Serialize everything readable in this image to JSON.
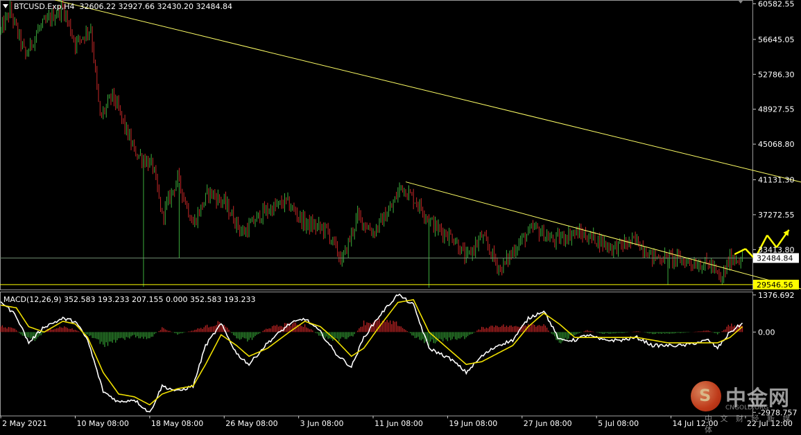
{
  "header": {
    "symbol": "BTCUSD.Exp,H4",
    "ohlc": "32606.22 32927.66 32430.20 32484.84"
  },
  "macd_header": "MACD(12,26,9) 352.583 193.233 207.155 0.000 352.583 193.233",
  "watermark": {
    "title": "中金网",
    "sub_en": "CNGOLD.ORG",
    "sub_cn": "中 文 财 经 新 媒 体"
  },
  "colors": {
    "background": "#000000",
    "bull": "#3dae3d",
    "bear": "#c82828",
    "trendline": "#ffff66",
    "support": "#ffff00",
    "price_level": "#6e8a70",
    "macd_line": "#ffffff",
    "signal_line": "#f0e000",
    "hist_pos": "#b22222",
    "hist_neg": "#2e8b2e",
    "axis_text": "#ffffff"
  },
  "chart_data": [
    {
      "type": "candlestick",
      "title": "BTCUSD.Exp,H4",
      "ylim": [
        29000,
        61000
      ],
      "y_ticks": [
        "60582.55",
        "56645.05",
        "52786.30",
        "48927.55",
        "45068.80",
        "41131.30",
        "37272.55",
        "33413.80"
      ],
      "y_tick_values": [
        60582.55,
        56645.05,
        52786.3,
        48927.55,
        45068.8,
        41131.3,
        37272.55,
        33413.8
      ],
      "x_ticks": [
        "2 May 2021",
        "10 May 08:00",
        "18 May 08:00",
        "26 May 08:00",
        "3 Jun 08:00",
        "11 Jun 08:00",
        "19 Jun 08:00",
        "27 Jun 08:00",
        "5 Jul 08:00",
        "14 Jul 12:00",
        "22 Jul 12:00"
      ],
      "x_tick_values": [
        0,
        48,
        96,
        144,
        192,
        240,
        288,
        336,
        384,
        432,
        480
      ],
      "current_price": {
        "label": "32484.84",
        "value": 32484.84
      },
      "support_level": {
        "label": "29546.56",
        "value": 29546.56
      },
      "trendlines": [
        {
          "name": "upper-resistance",
          "from": [
            35,
            61000
          ],
          "to": [
            520,
            40700
          ]
        },
        {
          "name": "lower-resistance",
          "from": [
            261,
            40900
          ],
          "to": [
            520,
            28880
          ]
        }
      ],
      "forecast_path": [
        [
          473,
          32900
        ],
        [
          480,
          33500
        ],
        [
          486,
          32400
        ],
        [
          494,
          35000
        ],
        [
          500,
          33650
        ],
        [
          508,
          35600
        ]
      ],
      "price_path": [
        [
          0,
          57600
        ],
        [
          6,
          59800
        ],
        [
          16,
          54800
        ],
        [
          24,
          57700
        ],
        [
          34,
          59300
        ],
        [
          40,
          60200
        ],
        [
          48,
          56200
        ],
        [
          58,
          57900
        ],
        [
          64,
          47900
        ],
        [
          72,
          50500
        ],
        [
          86,
          44300
        ],
        [
          98,
          42600
        ],
        [
          104,
          37100
        ],
        [
          114,
          41300
        ],
        [
          124,
          36200
        ],
        [
          134,
          39800
        ],
        [
          144,
          38600
        ],
        [
          156,
          35200
        ],
        [
          168,
          37400
        ],
        [
          184,
          38700
        ],
        [
          196,
          36300
        ],
        [
          210,
          35600
        ],
        [
          220,
          32100
        ],
        [
          230,
          37100
        ],
        [
          240,
          35300
        ],
        [
          252,
          38100
        ],
        [
          258,
          40500
        ],
        [
          268,
          38700
        ],
        [
          280,
          35900
        ],
        [
          292,
          34700
        ],
        [
          300,
          32400
        ],
        [
          310,
          34900
        ],
        [
          322,
          31200
        ],
        [
          334,
          34200
        ],
        [
          344,
          35800
        ],
        [
          356,
          34400
        ],
        [
          370,
          35300
        ],
        [
          384,
          34600
        ],
        [
          394,
          33600
        ],
        [
          410,
          34400
        ],
        [
          420,
          32600
        ],
        [
          434,
          32400
        ],
        [
          448,
          31900
        ],
        [
          458,
          31700
        ],
        [
          464,
          29900
        ],
        [
          470,
          32400
        ],
        [
          478,
          32484
        ]
      ]
    },
    {
      "type": "line",
      "title": "MACD(12,26,9)",
      "ylim": [
        -3100,
        1500
      ],
      "y_ticks": [
        "1376.692",
        "0.00",
        "-2978.757"
      ],
      "y_tick_values": [
        1376.692,
        0,
        -2978.757
      ],
      "series": [
        {
          "name": "MACD",
          "points": [
            [
              0,
              1150
            ],
            [
              10,
              600
            ],
            [
              18,
              -400
            ],
            [
              28,
              200
            ],
            [
              40,
              500
            ],
            [
              48,
              400
            ],
            [
              56,
              -300
            ],
            [
              66,
              -2200
            ],
            [
              76,
              -2600
            ],
            [
              86,
              -2500
            ],
            [
              96,
              -3000
            ],
            [
              104,
              -2000
            ],
            [
              114,
              -2200
            ],
            [
              124,
              -2000
            ],
            [
              132,
              -500
            ],
            [
              142,
              300
            ],
            [
              152,
              -800
            ],
            [
              160,
              -1200
            ],
            [
              172,
              -400
            ],
            [
              186,
              300
            ],
            [
              196,
              500
            ],
            [
              206,
              0
            ],
            [
              216,
              -800
            ],
            [
              226,
              -1300
            ],
            [
              234,
              -200
            ],
            [
              244,
              600
            ],
            [
              256,
              1400
            ],
            [
              266,
              1000
            ],
            [
              276,
              -600
            ],
            [
              290,
              -1000
            ],
            [
              300,
              -1500
            ],
            [
              310,
              -900
            ],
            [
              320,
              -500
            ],
            [
              330,
              -300
            ],
            [
              340,
              500
            ],
            [
              350,
              800
            ],
            [
              360,
              -300
            ],
            [
              370,
              -300
            ],
            [
              378,
              -100
            ],
            [
              388,
              -300
            ],
            [
              400,
              -300
            ],
            [
              410,
              -200
            ],
            [
              420,
              -500
            ],
            [
              430,
              -500
            ],
            [
              440,
              -500
            ],
            [
              456,
              -300
            ],
            [
              462,
              -600
            ],
            [
              470,
              0
            ],
            [
              480,
              400
            ]
          ]
        },
        {
          "name": "Signal",
          "points": [
            [
              0,
              1000
            ],
            [
              10,
              900
            ],
            [
              18,
              200
            ],
            [
              28,
              0
            ],
            [
              40,
              400
            ],
            [
              48,
              300
            ],
            [
              56,
              -200
            ],
            [
              66,
              -1500
            ],
            [
              76,
              -2300
            ],
            [
              86,
              -2400
            ],
            [
              96,
              -2700
            ],
            [
              104,
              -2300
            ],
            [
              114,
              -2100
            ],
            [
              124,
              -2000
            ],
            [
              132,
              -1200
            ],
            [
              142,
              -100
            ],
            [
              152,
              -500
            ],
            [
              160,
              -900
            ],
            [
              172,
              -600
            ],
            [
              186,
              0
            ],
            [
              196,
              400
            ],
            [
              206,
              200
            ],
            [
              216,
              -300
            ],
            [
              226,
              -900
            ],
            [
              234,
              -600
            ],
            [
              244,
              200
            ],
            [
              256,
              1100
            ],
            [
              266,
              1200
            ],
            [
              276,
              0
            ],
            [
              290,
              -700
            ],
            [
              300,
              -1200
            ],
            [
              310,
              -1100
            ],
            [
              320,
              -800
            ],
            [
              330,
              -500
            ],
            [
              340,
              200
            ],
            [
              350,
              700
            ],
            [
              360,
              300
            ],
            [
              370,
              -200
            ],
            [
              378,
              -200
            ],
            [
              388,
              -200
            ],
            [
              400,
              -200
            ],
            [
              410,
              -200
            ],
            [
              420,
              -300
            ],
            [
              430,
              -400
            ],
            [
              440,
              -400
            ],
            [
              456,
              -400
            ],
            [
              462,
              -400
            ],
            [
              470,
              -200
            ],
            [
              480,
              300
            ]
          ]
        },
        {
          "name": "Histogram",
          "points": [
            [
              0,
              200
            ],
            [
              8,
              150
            ],
            [
              14,
              -120
            ],
            [
              22,
              -300
            ],
            [
              30,
              100
            ],
            [
              40,
              200
            ],
            [
              48,
              80
            ],
            [
              56,
              -100
            ],
            [
              66,
              -450
            ],
            [
              76,
              -300
            ],
            [
              86,
              -150
            ],
            [
              96,
              -250
            ],
            [
              104,
              150
            ],
            [
              114,
              -80
            ],
            [
              124,
              60
            ],
            [
              132,
              200
            ],
            [
              142,
              350
            ],
            [
              152,
              -200
            ],
            [
              160,
              -300
            ],
            [
              172,
              150
            ],
            [
              186,
              300
            ],
            [
              196,
              250
            ],
            [
              206,
              -150
            ],
            [
              216,
              -300
            ],
            [
              226,
              -200
            ],
            [
              234,
              350
            ],
            [
              244,
              400
            ],
            [
              256,
              300
            ],
            [
              266,
              -150
            ],
            [
              276,
              -400
            ],
            [
              290,
              -250
            ],
            [
              300,
              -200
            ],
            [
              310,
              150
            ],
            [
              320,
              250
            ],
            [
              330,
              200
            ],
            [
              340,
              300
            ],
            [
              350,
              250
            ],
            [
              360,
              -350
            ],
            [
              370,
              -100
            ],
            [
              378,
              60
            ],
            [
              388,
              -60
            ],
            [
              400,
              -40
            ],
            [
              410,
              30
            ],
            [
              420,
              -60
            ],
            [
              430,
              -50
            ],
            [
              440,
              -30
            ],
            [
              456,
              60
            ],
            [
              462,
              -80
            ],
            [
              470,
              250
            ],
            [
              480,
              200
            ]
          ]
        }
      ]
    }
  ]
}
